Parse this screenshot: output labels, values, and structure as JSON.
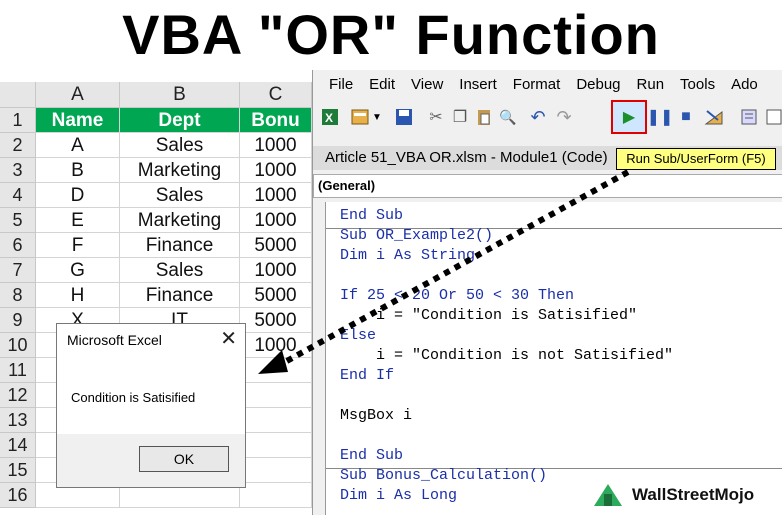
{
  "title": "VBA \"OR\" Function",
  "sheet": {
    "columns": [
      "A",
      "B",
      "C"
    ],
    "row_numbers": [
      "1",
      "2",
      "3",
      "4",
      "5",
      "6",
      "7",
      "8",
      "9",
      "10",
      "11",
      "12",
      "13",
      "14",
      "15",
      "16"
    ],
    "header": [
      "Name",
      "Dept",
      "Bonu"
    ],
    "rows": [
      [
        "A",
        "Sales",
        "1000"
      ],
      [
        "B",
        "Marketing",
        "1000"
      ],
      [
        "D",
        "Sales",
        "1000"
      ],
      [
        "E",
        "Marketing",
        "1000"
      ],
      [
        "F",
        "Finance",
        "5000"
      ],
      [
        "G",
        "Sales",
        "1000"
      ],
      [
        "H",
        "Finance",
        "5000"
      ],
      [
        "X",
        "IT",
        "5000"
      ],
      [
        "",
        "",
        "1000"
      ]
    ],
    "header_color": "#00a651"
  },
  "vbe": {
    "menus": [
      "File",
      "Edit",
      "View",
      "Insert",
      "Format",
      "Debug",
      "Run",
      "Tools",
      "Ado"
    ],
    "toolbar_icons": [
      "excel-icon",
      "insert-module-icon",
      "dropdown-arrow-icon",
      "save-icon",
      "cut-icon",
      "copy-icon",
      "paste-icon",
      "find-icon",
      "undo-icon",
      "redo-icon",
      "run-icon",
      "pause-icon",
      "stop-icon",
      "design-mode-icon",
      "project-explorer-icon"
    ],
    "window_title": "Article 51_VBA OR.xlsm - Module1 (Code)",
    "tooltip": "Run Sub/UserForm (F5)",
    "general_combo": "(General)",
    "code": [
      "End Sub",
      "Sub OR_Example2()",
      "Dim i As String",
      "",
      "If 25 < 20 Or 50 < 30 Then",
      "    i = \"Condition is Satisified\"",
      "Else",
      "    i = \"Condition is not Satisified\"",
      "End If",
      "",
      "MsgBox i",
      "",
      "End Sub",
      "Sub Bonus_Calculation()",
      "Dim i As Long"
    ],
    "run_highlight_color": "#e00000"
  },
  "msgbox": {
    "title": "Microsoft Excel",
    "close": "✕",
    "message": "Condition is Satisified",
    "ok_label": "OK"
  },
  "watermark": "WallStreetMojo"
}
